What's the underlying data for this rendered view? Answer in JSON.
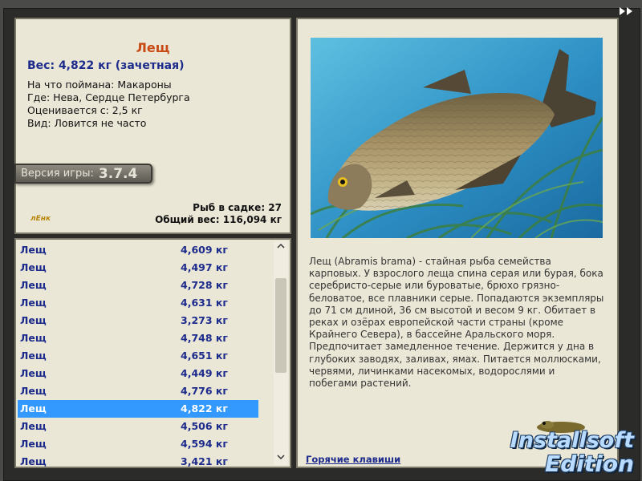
{
  "info": {
    "title": "Лещ",
    "weight": "Вес: 4,822 кг (зачетная)",
    "lines": [
      "На что поймана: Макароны",
      "Где: Нева, Сердце Петербурга",
      "Оценивается с: 2,5 кг",
      "Вид: Ловится не часто"
    ],
    "version_label": "Версия игры:",
    "version_number": "3.7.4",
    "logo_text": "лEнк",
    "stats": {
      "in_keepnet": "Рыб в садке: 27",
      "total_weight": "Общий вес: 116,094 кг"
    }
  },
  "catch_list": {
    "selected_index": 9,
    "rows": [
      {
        "name": "Лещ",
        "weight": "4,609 кг"
      },
      {
        "name": "Лещ",
        "weight": "4,497 кг"
      },
      {
        "name": "Лещ",
        "weight": "4,728 кг"
      },
      {
        "name": "Лещ",
        "weight": "4,631 кг"
      },
      {
        "name": "Лещ",
        "weight": "3,273 кг"
      },
      {
        "name": "Лещ",
        "weight": "4,748 кг"
      },
      {
        "name": "Лещ",
        "weight": "4,651 кг"
      },
      {
        "name": "Лещ",
        "weight": "4,449 кг"
      },
      {
        "name": "Лещ",
        "weight": "4,776 кг"
      },
      {
        "name": "Лещ",
        "weight": "4,822 кг"
      },
      {
        "name": "Лещ",
        "weight": "4,506 кг"
      },
      {
        "name": "Лещ",
        "weight": "4,594 кг"
      },
      {
        "name": "Лещ",
        "weight": "3,421 кг"
      }
    ]
  },
  "description": "Лещ (Abramis brama) - стайная рыба семейства карповых. У взрослого леща спина серая или бурая, бока серебристо-серые или буроватые, брюхо грязно-беловатое, все плавники серые. Попадаются экземпляры до 71 см длиной, 36 см высотой и весом 9 кг. Обитает в реках и озёрах европейской части страны (кроме Крайнего Севера), в бассейне Аральского моря. Предпочитает замедленное течение. Держится у дна в глубоких заводях, заливах, ямах. Питается моллюсками, червями, личинками насекомых, водорослями и побегами растений.",
  "hotkeys_link": "Горячие клавиши",
  "brand": {
    "line1": "Installsoft",
    "line2": "Edition"
  },
  "icons": {
    "next": "double-chevron-right-icon",
    "scroll_up": "chevron-up-icon",
    "scroll_down": "chevron-down-icon"
  },
  "colors": {
    "title": "#c84a14",
    "accent_text": "#1c2b8c",
    "selection": "#3399ff",
    "panel_bg": "#ebe7d6"
  }
}
